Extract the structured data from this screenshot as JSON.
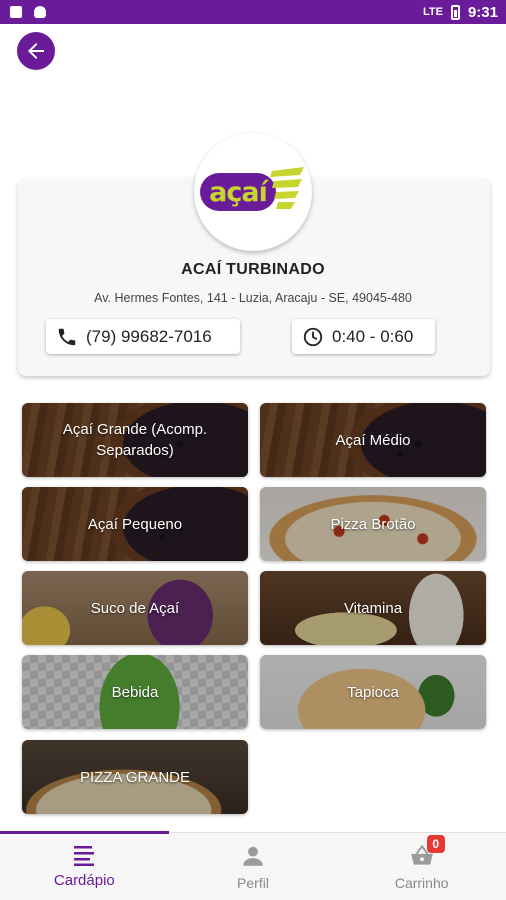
{
  "status_bar": {
    "time": "9:31",
    "signal": "LTE"
  },
  "store": {
    "logo_text": "açaí",
    "name": "ACAÍ TURBINADO",
    "address": "Av. Hermes Fontes, 141 - Luzia, Aracaju - SE, 49045-480",
    "phone": "(79) 99682-7016",
    "hours": "0:40 - 0:60"
  },
  "categories": [
    {
      "label": "Açaí Grande (Acomp. Separados)"
    },
    {
      "label": "Açaí Médio"
    },
    {
      "label": "Açaí Pequeno"
    },
    {
      "label": "Pizza Brotão"
    },
    {
      "label": "Suco de Açaí"
    },
    {
      "label": "Vitamina"
    },
    {
      "label": "Bebida"
    },
    {
      "label": "Tapioca"
    },
    {
      "label": "PIZZA GRANDE"
    }
  ],
  "bottom_nav": {
    "items": [
      {
        "label": "Cardápio",
        "icon": "menu-list-icon",
        "active": true
      },
      {
        "label": "Perfil",
        "icon": "person-icon",
        "active": false
      },
      {
        "label": "Carrinho",
        "icon": "basket-icon",
        "active": false
      }
    ],
    "cart_count": "0"
  },
  "colors": {
    "primary": "#6a1b9a",
    "accent": "#c6d62e",
    "badge": "#e53935"
  }
}
